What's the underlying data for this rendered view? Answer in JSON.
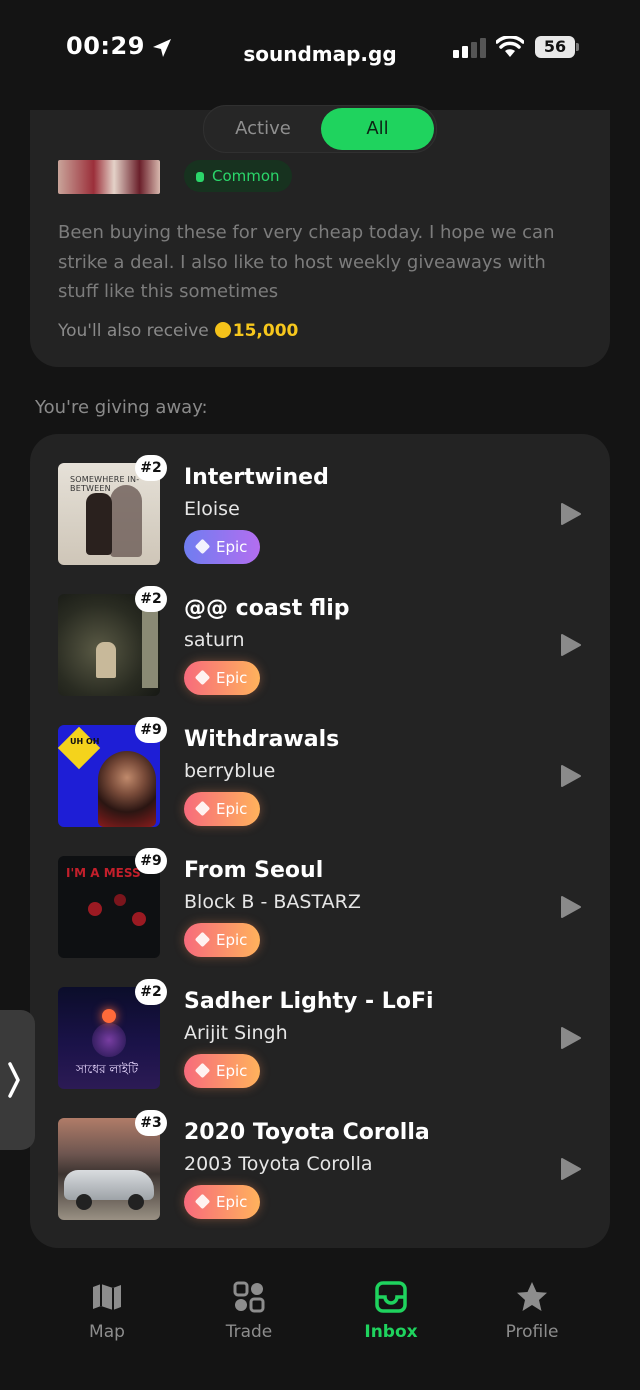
{
  "status_bar": {
    "time": "00:29",
    "url": "soundmap.gg",
    "battery": "56"
  },
  "filter": {
    "active_label": "Active",
    "all_label": "All",
    "selected": "All"
  },
  "offer": {
    "rarity": "Common",
    "message": "Been buying these for very cheap today.  I hope we can strike a deal. I also like to host weekly giveaways with stuff like this sometimes",
    "receive_prefix": "You'll also receive",
    "coin_amount": "15,000"
  },
  "giving_label": "You're giving away:",
  "tracks": [
    {
      "rank": "#2",
      "title": "Intertwined",
      "artist": "Eloise",
      "rarity": "Epic",
      "cover_text": "SOMEWHERE IN-BETWEEN"
    },
    {
      "rank": "#2",
      "title": "@@ coast flip",
      "artist": "saturn",
      "rarity": "Epic"
    },
    {
      "rank": "#9",
      "title": "Withdrawals",
      "artist": "berryblue",
      "rarity": "Epic",
      "cover_text": "UH OH"
    },
    {
      "rank": "#9",
      "title": "From Seoul",
      "artist": "Block B - BASTARZ",
      "rarity": "Epic",
      "cover_text": "I'M A MESS"
    },
    {
      "rank": "#2",
      "title": "Sadher Lighty - LoFi",
      "artist": "Arijit Singh",
      "rarity": "Epic",
      "cover_text": "সাধের লাইটি"
    },
    {
      "rank": "#3",
      "title": "2020 Toyota Corolla",
      "artist": "2003 Toyota Corolla",
      "rarity": "Epic"
    }
  ],
  "tab_bar": [
    {
      "label": "Map",
      "icon": "map-icon"
    },
    {
      "label": "Trade",
      "icon": "trade-icon"
    },
    {
      "label": "Inbox",
      "icon": "inbox-icon",
      "active": true
    },
    {
      "label": "Profile",
      "icon": "star-icon"
    }
  ],
  "colors": {
    "accent": "#1fd35e",
    "coin": "#f6c71d",
    "background": "#141414",
    "card": "#232323"
  }
}
